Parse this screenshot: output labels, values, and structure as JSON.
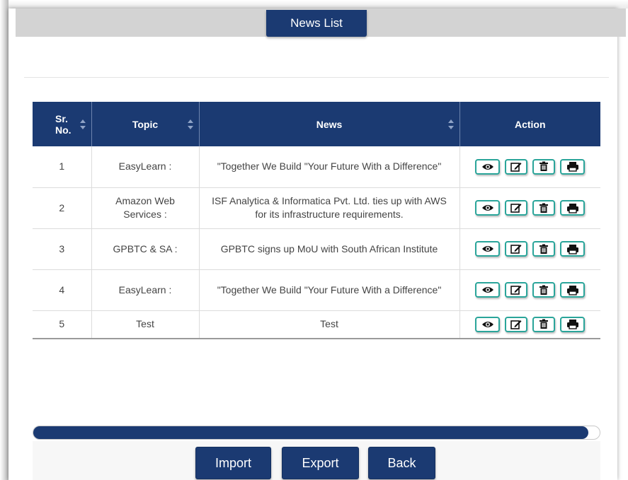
{
  "header": {
    "title": "News List"
  },
  "table": {
    "columns": [
      "Sr. No.",
      "Topic",
      "News",
      "Action"
    ],
    "columns_split": {
      "sr_line1": "Sr.",
      "sr_line2": "No."
    },
    "rows": [
      {
        "sr": "1",
        "topic": "EasyLearn :",
        "news": "\"Together We Build \"Your Future With a Difference\""
      },
      {
        "sr": "2",
        "topic": "Amazon Web Services :",
        "news": "ISF Analytica & Informatica Pvt. Ltd. ties up with AWS for its infrastructure requirements."
      },
      {
        "sr": "3",
        "topic": "GPBTC & SA :",
        "news": "GPBTC signs up MoU with South African Institute"
      },
      {
        "sr": "4",
        "topic": "EasyLearn :",
        "news": "\"Together We Build \"Your Future With a Difference\""
      },
      {
        "sr": "5",
        "topic": "Test",
        "news": "Test"
      }
    ],
    "action_icons": [
      "eye-icon",
      "edit-icon",
      "trash-icon",
      "print-icon"
    ]
  },
  "scroll": {
    "position_fraction": 0.98
  },
  "footer": {
    "import_label": "Import",
    "export_label": "Export",
    "back_label": "Back"
  },
  "colors": {
    "primary": "#1b3a72",
    "action_border": "#2aa59a",
    "header_bar": "#d3d3d3"
  }
}
